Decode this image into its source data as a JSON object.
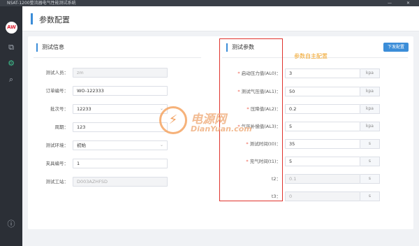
{
  "window": {
    "title": "NSAT-1200整流器电气性能测试系统",
    "minimize": "—",
    "close": "✕"
  },
  "sidebar": {
    "logo_text": "AW",
    "icons": [
      "copy-icon",
      "gear-icon",
      "search-icon",
      "info-icon"
    ]
  },
  "header": {
    "title": "参数配置"
  },
  "left_section": {
    "title": "测试信息",
    "fields": [
      {
        "label": "测试人员：",
        "value": "zm",
        "disabled": true
      },
      {
        "label": "订单编号：",
        "value": "WO-122333",
        "disabled": false
      },
      {
        "label": "批次号：",
        "value": "12233",
        "disabled": false,
        "dropdown": true
      },
      {
        "label": "周期：",
        "value": "123",
        "disabled": false
      },
      {
        "label": "测试环境：",
        "value": "初始",
        "disabled": false,
        "dropdown": true
      },
      {
        "label": "夹具编号：",
        "value": "1",
        "disabled": false
      },
      {
        "label": "测试工站：",
        "value": "D003AZHFSD",
        "disabled": true
      }
    ]
  },
  "right_section": {
    "title": "测试参数",
    "button_label": "下发配置",
    "annotation": "参数自主配置",
    "params": [
      {
        "label": "启动压力值(AL0)：",
        "required": true,
        "value": "3",
        "unit": "kpa",
        "disabled": false
      },
      {
        "label": "测试气压值(AL1)：",
        "required": true,
        "value": "50",
        "unit": "kpa",
        "disabled": false
      },
      {
        "label": "压降值(AL2)：",
        "required": true,
        "value": "0.2",
        "unit": "kpa",
        "disabled": false
      },
      {
        "label": "气压补偿值(AL3)：",
        "required": true,
        "value": "5",
        "unit": "kpa",
        "disabled": false
      },
      {
        "label": "测试时间(t0)：",
        "required": true,
        "value": "35",
        "unit": "s",
        "disabled": false
      },
      {
        "label": "充气时间(t1)：",
        "required": true,
        "value": "5",
        "unit": "s",
        "disabled": false
      },
      {
        "label": "t2：",
        "required": false,
        "value": "0.1",
        "unit": "s",
        "disabled": true
      },
      {
        "label": "t3：",
        "required": false,
        "value": "0",
        "unit": "s",
        "disabled": true
      }
    ]
  },
  "watermark": {
    "line1": "电源网",
    "line2": "DianYuan.com"
  },
  "colors": {
    "accent": "#3b8dd8",
    "sidebar": "#2b2f36",
    "highlight_box": "#e0332d",
    "annotation": "#f0a020"
  }
}
